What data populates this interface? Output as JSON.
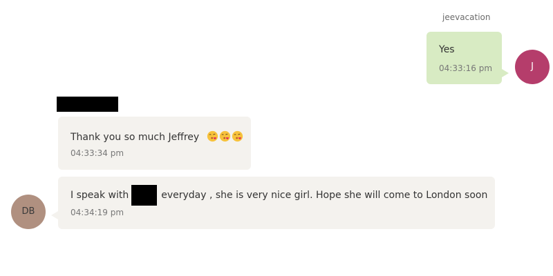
{
  "outgoing": {
    "sender_name": "jeevacation",
    "avatar_initial": "J",
    "avatar_color": "#b53d6b",
    "bubble_color": "#d8ebc3",
    "message": {
      "text": "Yes",
      "time": "04:33:16 pm"
    }
  },
  "incoming": {
    "sender_name_redacted": true,
    "avatar_initials": "DB",
    "avatar_color": "#b09080",
    "bubble_color": "#f4f2ee",
    "messages": [
      {
        "text": "Thank you so much Jeffrey",
        "emojis": [
          "face-blowing-a-kiss-icon",
          "face-blowing-a-kiss-icon",
          "face-blowing-a-kiss-icon"
        ],
        "time": "04:33:34 pm"
      },
      {
        "text_before": "I speak with",
        "text_after": "everyday , she is very nice girl. Hope she will come to London soon",
        "time": "04:34:19 pm"
      }
    ]
  }
}
